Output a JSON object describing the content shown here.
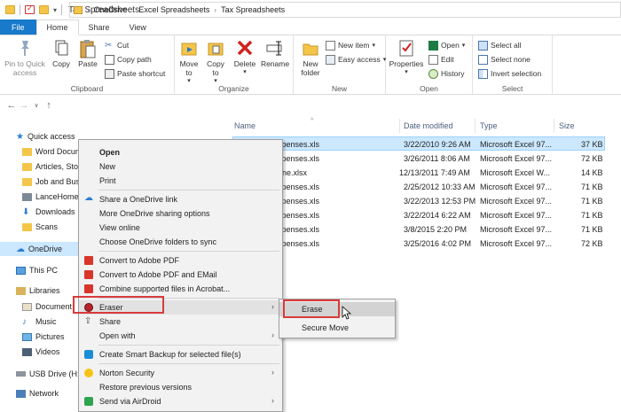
{
  "window": {
    "title": "Tax Spreadsheets"
  },
  "ribbon": {
    "tabs": [
      "File",
      "Home",
      "Share",
      "View"
    ],
    "clipboard": {
      "label": "Clipboard",
      "pin": "Pin to Quick access",
      "copy": "Copy",
      "paste": "Paste",
      "cut": "Cut",
      "copy_path": "Copy path",
      "paste_shortcut": "Paste shortcut"
    },
    "organize": {
      "label": "Organize",
      "move_to": "Move to",
      "copy_to": "Copy to",
      "delete": "Delete",
      "rename": "Rename"
    },
    "new": {
      "label": "New",
      "new_folder": "New folder",
      "new_item": "New item",
      "easy_access": "Easy access"
    },
    "open": {
      "label": "Open",
      "properties": "Properties",
      "open": "Open",
      "edit": "Edit",
      "history": "History"
    },
    "select": {
      "label": "Select",
      "select_all": "Select all",
      "select_none": "Select none",
      "invert": "Invert selection"
    }
  },
  "address": {
    "crumbs": [
      "OneDrive",
      "Excel Spreadsheets",
      "Tax Spreadsheets"
    ]
  },
  "navpane": {
    "items": [
      "Quick access",
      "Word Docum",
      "Articles, Stor",
      "Job and Bus",
      "LanceHome",
      "Downloads",
      "Scans",
      "OneDrive",
      "This PC",
      "Libraries",
      "Document",
      "Music",
      "Pictures",
      "Videos",
      "USB Drive (H:)",
      "Network"
    ]
  },
  "filelist": {
    "columns": [
      "Name",
      "Date modified",
      "Type",
      "Size"
    ],
    "rows": [
      {
        "name": "xpenses.xls",
        "date": "3/22/2010 9:26 AM",
        "type": "Microsoft Excel 97...",
        "size": "37 KB"
      },
      {
        "name": "xpenses.xls",
        "date": "3/26/2011 8:06 AM",
        "type": "Microsoft Excel 97...",
        "size": "72 KB"
      },
      {
        "name": "ne.xlsx",
        "date": "12/13/2011 7:49 AM",
        "type": "Microsoft Excel W...",
        "size": "14 KB"
      },
      {
        "name": "xpenses.xls",
        "date": "2/25/2012 10:33 AM",
        "type": "Microsoft Excel 97...",
        "size": "71 KB"
      },
      {
        "name": "xpenses.xls",
        "date": "3/22/2013 12:53 PM",
        "type": "Microsoft Excel 97...",
        "size": "71 KB"
      },
      {
        "name": "xpenses.xls",
        "date": "3/22/2014 6:22 AM",
        "type": "Microsoft Excel 97...",
        "size": "71 KB"
      },
      {
        "name": "xpenses.xls",
        "date": "3/8/2015 2:20 PM",
        "type": "Microsoft Excel 97...",
        "size": "71 KB"
      },
      {
        "name": "xpenses.xls",
        "date": "3/25/2016 4:02 PM",
        "type": "Microsoft Excel 97...",
        "size": "72 KB"
      }
    ]
  },
  "context_menu": {
    "items": [
      "Open",
      "New",
      "Print",
      "Share a OneDrive link",
      "More OneDrive sharing options",
      "View online",
      "Choose OneDrive folders to sync",
      "Convert to Adobe PDF",
      "Convert to Adobe PDF and EMail",
      "Combine supported files in Acrobat...",
      "Eraser",
      "Share",
      "Open with",
      "Create Smart Backup for selected file(s)",
      "Norton Security",
      "Restore previous versions",
      "Send via AirDroid"
    ]
  },
  "submenu": {
    "items": [
      "Erase",
      "Secure Move"
    ]
  },
  "colors": {
    "accent": "#1979ca",
    "selection": "#cce8ff",
    "highlight_box": "#d83b3b"
  }
}
